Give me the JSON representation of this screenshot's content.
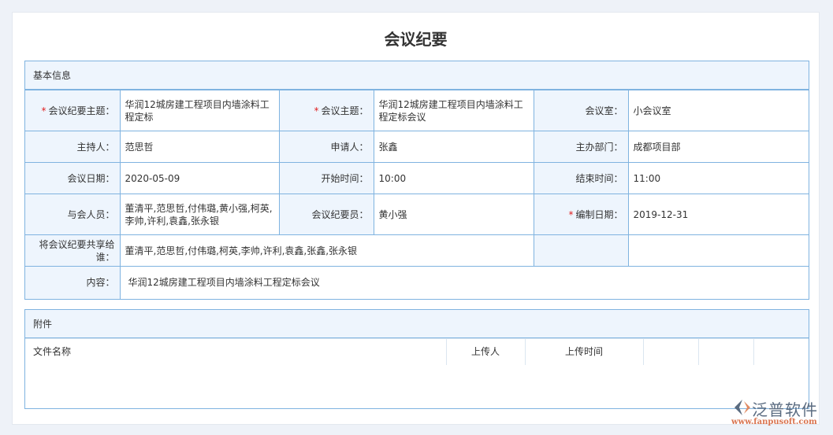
{
  "title": "会议纪要",
  "basic": {
    "header": "基本信息",
    "rows": [
      [
        {
          "label": "会议纪要主题：",
          "req": true,
          "value": "华润12城房建工程项目内墙涂料工程定标"
        },
        {
          "label": "会议主题：",
          "req": true,
          "value": "华润12城房建工程项目内墙涂料工程定标会议"
        },
        {
          "label": "会议室：",
          "value": "小会议室"
        }
      ],
      [
        {
          "label": "主持人：",
          "value": "范思哲"
        },
        {
          "label": "申请人：",
          "value": "张鑫"
        },
        {
          "label": "主办部门：",
          "value": "成都项目部"
        }
      ],
      [
        {
          "label": "会议日期：",
          "value": "2020-05-09"
        },
        {
          "label": "开始时间：",
          "value": "10:00"
        },
        {
          "label": "结束时间：",
          "value": "11:00"
        }
      ],
      [
        {
          "label": "与会人员：",
          "value": "董清平,范思哲,付伟璐,黄小强,柯英,李帅,许利,袁鑫,张永银"
        },
        {
          "label": "会议纪要员：",
          "value": "黄小强"
        },
        {
          "label": "编制日期：",
          "req": true,
          "value": "2019-12-31"
        }
      ]
    ],
    "share": {
      "label": "将会议纪要共享给谁：",
      "value": "董清平,范思哲,付伟璐,柯英,李帅,许利,袁鑫,张鑫,张永银"
    },
    "content": {
      "label": "内容：",
      "value": "华润12城房建工程项目内墙涂料工程定标会议"
    }
  },
  "attachments": {
    "header": "附件",
    "columns": [
      "文件名称",
      "上传人",
      "上传时间"
    ]
  },
  "logo": {
    "name": "泛普软件",
    "url": "www.fanpusoft.com"
  },
  "colors": {
    "border": "#7fb3e0",
    "label_bg": "#eef5fd",
    "required": "#e02020"
  }
}
